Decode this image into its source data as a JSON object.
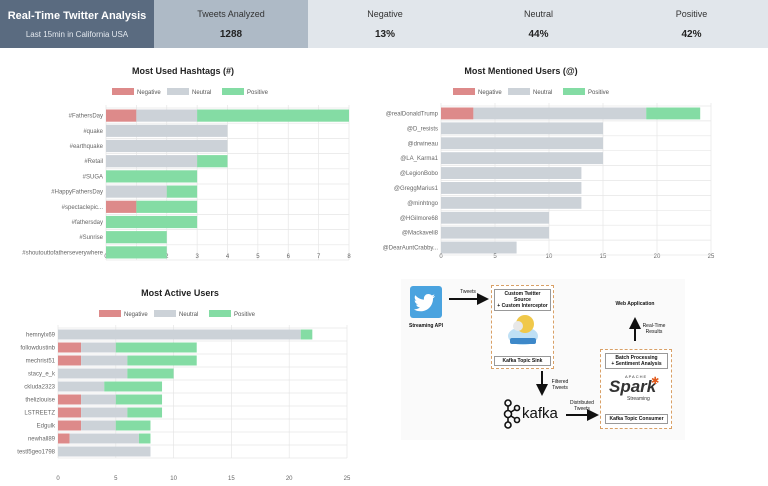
{
  "header": {
    "title": "Real-Time Twitter Analysis",
    "subtitle": "Last 15min in California USA",
    "stats": [
      {
        "label": "Tweets Analyzed",
        "value": "1288"
      },
      {
        "label": "Negative",
        "value": "13%"
      },
      {
        "label": "Neutral",
        "value": "44%"
      },
      {
        "label": "Positive",
        "value": "42%"
      }
    ]
  },
  "legend": {
    "negative": "Negative",
    "neutral": "Neutral",
    "positive": "Positive"
  },
  "colors": {
    "negative": "#dd8a8a",
    "neutral": "#ccd2d8",
    "positive": "#84dca4",
    "grid": "#e6e6e6",
    "header_dark": "#5a6b80",
    "header_mid": "#aebac6",
    "header_light": "#e1e6eb"
  },
  "chart_data": [
    {
      "type": "bar",
      "orientation": "horizontal",
      "stacked": true,
      "title": "Most Used Hashtags (#)",
      "categories": [
        "#FathersDay",
        "#quake",
        "#earthquake",
        "#Retail",
        "#SUGA",
        "#HappyFathersDay",
        "#spectaclepic...",
        "#fathersday",
        "#Sunrise",
        "#shoutouttofatherseverywhere"
      ],
      "series": [
        {
          "name": "Negative",
          "values": [
            1,
            0,
            0,
            0,
            0,
            0,
            1,
            0,
            0,
            0
          ]
        },
        {
          "name": "Neutral",
          "values": [
            2,
            4,
            4,
            3,
            0,
            2,
            0,
            0,
            0,
            0
          ]
        },
        {
          "name": "Positive",
          "values": [
            5,
            0,
            0,
            1,
            3,
            1,
            2,
            3,
            2,
            2
          ]
        }
      ],
      "xlim": [
        0,
        8
      ],
      "xticks": [
        0,
        1,
        2,
        3,
        4,
        5,
        6,
        7,
        8
      ],
      "grid": true,
      "legend_position": "top"
    },
    {
      "type": "bar",
      "orientation": "horizontal",
      "stacked": true,
      "title": "Most Mentioned Users (@)",
      "categories": [
        "@realDonaldTrump",
        "@D_resists",
        "@drwineau",
        "@LA_Karma1",
        "@LegionBobo",
        "@GreggMarius1",
        "@minhtngo",
        "@HGilmore68",
        "@Mackaveli8",
        "@DearAuntCrabby..."
      ],
      "series": [
        {
          "name": "Negative",
          "values": [
            3,
            0,
            0,
            0,
            0,
            0,
            0,
            0,
            0,
            0
          ]
        },
        {
          "name": "Neutral",
          "values": [
            16,
            15,
            15,
            15,
            13,
            13,
            13,
            10,
            10,
            7
          ]
        },
        {
          "name": "Positive",
          "values": [
            5,
            0,
            0,
            0,
            0,
            0,
            0,
            0,
            0,
            0
          ]
        }
      ],
      "xlim": [
        0,
        25
      ],
      "xticks": [
        0,
        5,
        10,
        15,
        20,
        25
      ],
      "grid": true,
      "legend_position": "top"
    },
    {
      "type": "bar",
      "orientation": "horizontal",
      "stacked": true,
      "title": "Most Active Users",
      "categories": [
        "hemnylx69",
        "followdustinb",
        "mechrist51",
        "stacy_e_k",
        "ckluda2323",
        "thelizlouise",
        "LSTREETZ",
        "Edgulk",
        "newhall89",
        "testl5geo1798"
      ],
      "series": [
        {
          "name": "Negative",
          "values": [
            0,
            2,
            2,
            0,
            0,
            2,
            2,
            2,
            1,
            0
          ]
        },
        {
          "name": "Neutral",
          "values": [
            21,
            3,
            4,
            6,
            4,
            3,
            4,
            3,
            6,
            8
          ]
        },
        {
          "name": "Positive",
          "values": [
            1,
            7,
            6,
            4,
            5,
            4,
            3,
            3,
            1,
            0
          ]
        }
      ],
      "xlim": [
        0,
        25
      ],
      "xticks": [
        0,
        5,
        10,
        15,
        20,
        25
      ],
      "grid": true,
      "legend_position": "top"
    }
  ],
  "architecture": {
    "twitter_label": "Streaming API",
    "tweets_label": "Tweets",
    "flume_top": "Custom Twitter Source\n+ Custom Interceptor",
    "flume_bottom": "Kafka Topic Sink",
    "filtered_label": "Filtered\nTweets",
    "kafka_label": "kafka",
    "distributed_label": "Distributed\nTweets",
    "spark_top": "Batch Processing\n+ Sentiment Analysis",
    "spark_word": "Spark",
    "spark_apache": "APACHE",
    "spark_streaming": "Streaming",
    "spark_bottom": "Kafka Topic Consumer",
    "realtime_label": "Real-Time\nResults",
    "webapp_label": "Web Application"
  }
}
